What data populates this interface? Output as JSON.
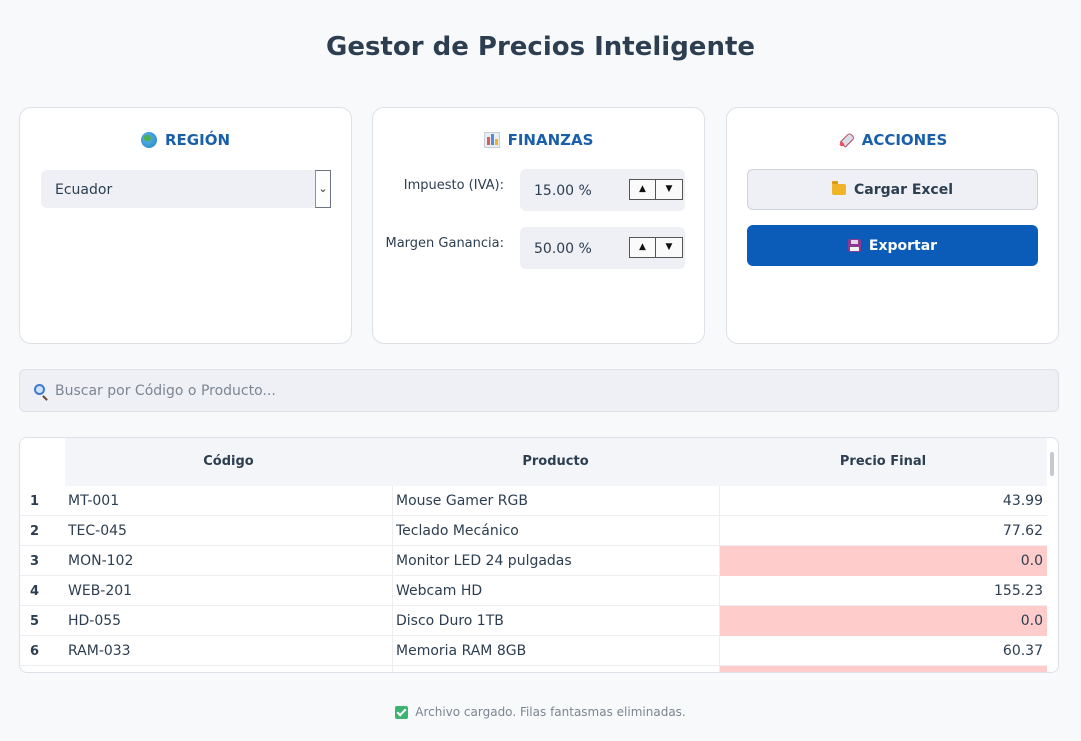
{
  "app": {
    "title": "Gestor de Precios Inteligente"
  },
  "region": {
    "header": "REGIÓN",
    "icon": "globe-icon",
    "selected": "Ecuador"
  },
  "finance": {
    "header": "FINANZAS",
    "icon": "bar-chart-icon",
    "tax_label": "Impuesto (IVA):",
    "tax_value": "15.00 %",
    "margin_label": "Margen Ganancia:",
    "margin_value": "50.00 %"
  },
  "actions": {
    "header": "ACCIONES",
    "icon": "rocket-icon",
    "load_label": "Cargar Excel",
    "export_label": "Exportar"
  },
  "search": {
    "placeholder": "Buscar por Código o Producto..."
  },
  "table": {
    "columns": [
      "Código",
      "Producto",
      "Precio Final"
    ],
    "rows": [
      {
        "num": "1",
        "code": "MT-001",
        "product": "Mouse Gamer RGB",
        "price": "43.99",
        "zero": false
      },
      {
        "num": "2",
        "code": "TEC-045",
        "product": "Teclado Mecánico",
        "price": "77.62",
        "zero": false
      },
      {
        "num": "3",
        "code": "MON-102",
        "product": "Monitor LED 24 pulgadas",
        "price": "0.0",
        "zero": true
      },
      {
        "num": "4",
        "code": "WEB-201",
        "product": "Webcam HD",
        "price": "155.23",
        "zero": false
      },
      {
        "num": "5",
        "code": "HD-055",
        "product": "Disco Duro 1TB",
        "price": "0.0",
        "zero": true
      },
      {
        "num": "6",
        "code": "RAM-033",
        "product": "Memoria RAM 8GB",
        "price": "60.37",
        "zero": false
      }
    ]
  },
  "status": {
    "text": "Archivo cargado. Filas fantasmas eliminadas."
  },
  "colors": {
    "accent": "#0a5cb8",
    "zero_price": "#ffcccc",
    "header_text": "#1a5faa"
  }
}
